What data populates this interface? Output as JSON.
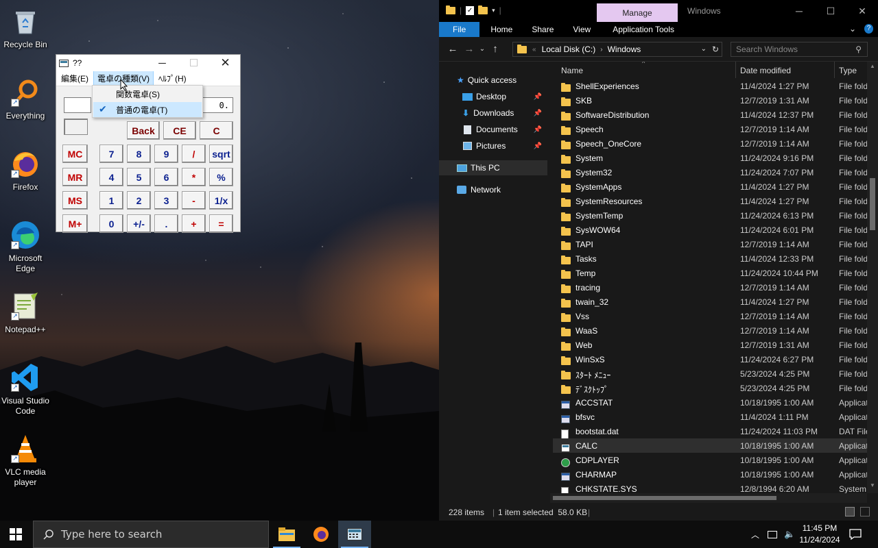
{
  "desktop": {
    "icons": [
      {
        "label": "Recycle Bin",
        "icon": "recycle-bin-icon"
      },
      {
        "label": "Everything",
        "icon": "everything-search-icon"
      },
      {
        "label": "Firefox",
        "icon": "firefox-icon"
      },
      {
        "label": "Microsoft Edge",
        "icon": "edge-icon"
      },
      {
        "label": "Notepad++",
        "icon": "notepadpp-icon"
      },
      {
        "label": "Visual Studio Code",
        "icon": "vscode-icon"
      },
      {
        "label": "VLC media player",
        "icon": "vlc-icon"
      }
    ]
  },
  "calculator": {
    "title": "??",
    "menu": [
      "編集(E)",
      "電卓の種類(V)",
      "ﾍﾙﾌﾟ(H)"
    ],
    "dropdown": [
      {
        "label": "関数電卓(S)",
        "checked": false
      },
      {
        "label": "普通の電卓(T)",
        "checked": true
      }
    ],
    "display": "0.",
    "buttons": {
      "back": "Back",
      "ce": "CE",
      "c": "C",
      "mc": "MC",
      "mr": "MR",
      "ms": "MS",
      "mplus": "M+",
      "n7": "7",
      "n8": "8",
      "n9": "9",
      "div": "/",
      "sqrt": "sqrt",
      "n4": "4",
      "n5": "5",
      "n6": "6",
      "mul": "*",
      "pct": "%",
      "n1": "1",
      "n2": "2",
      "n3": "3",
      "sub": "-",
      "recip": "1/x",
      "n0": "0",
      "sign": "+/-",
      "dot": ".",
      "add": "+",
      "eq": "="
    }
  },
  "explorer": {
    "title": "Windows",
    "context_tab": "Manage",
    "ribbon_tabs": [
      "File",
      "Home",
      "Share",
      "View",
      "Application Tools"
    ],
    "breadcrumb": [
      "Local Disk (C:)",
      "Windows"
    ],
    "search_placeholder": "Search Windows",
    "nav": {
      "quick_access": "Quick access",
      "desktop": "Desktop",
      "downloads": "Downloads",
      "documents": "Documents",
      "pictures": "Pictures",
      "this_pc": "This PC",
      "network": "Network"
    },
    "columns": [
      "Name",
      "Date modified",
      "Type"
    ],
    "files": [
      {
        "name": "ShellExperiences",
        "date": "11/4/2024 1:27 PM",
        "type": "File folder",
        "kind": "folder"
      },
      {
        "name": "SKB",
        "date": "12/7/2019 1:31 AM",
        "type": "File folder",
        "kind": "folder"
      },
      {
        "name": "SoftwareDistribution",
        "date": "11/4/2024 12:37 PM",
        "type": "File folder",
        "kind": "folder"
      },
      {
        "name": "Speech",
        "date": "12/7/2019 1:14 AM",
        "type": "File folder",
        "kind": "folder"
      },
      {
        "name": "Speech_OneCore",
        "date": "12/7/2019 1:14 AM",
        "type": "File folder",
        "kind": "folder"
      },
      {
        "name": "System",
        "date": "11/24/2024 9:16 PM",
        "type": "File folder",
        "kind": "folder"
      },
      {
        "name": "System32",
        "date": "11/24/2024 7:07 PM",
        "type": "File folder",
        "kind": "folder"
      },
      {
        "name": "SystemApps",
        "date": "11/4/2024 1:27 PM",
        "type": "File folder",
        "kind": "folder"
      },
      {
        "name": "SystemResources",
        "date": "11/4/2024 1:27 PM",
        "type": "File folder",
        "kind": "folder"
      },
      {
        "name": "SystemTemp",
        "date": "11/24/2024 6:13 PM",
        "type": "File folder",
        "kind": "folder"
      },
      {
        "name": "SysWOW64",
        "date": "11/24/2024 6:01 PM",
        "type": "File folder",
        "kind": "folder"
      },
      {
        "name": "TAPI",
        "date": "12/7/2019 1:14 AM",
        "type": "File folder",
        "kind": "folder"
      },
      {
        "name": "Tasks",
        "date": "11/4/2024 12:33 PM",
        "type": "File folder",
        "kind": "folder"
      },
      {
        "name": "Temp",
        "date": "11/24/2024 10:44 PM",
        "type": "File folder",
        "kind": "folder"
      },
      {
        "name": "tracing",
        "date": "12/7/2019 1:14 AM",
        "type": "File folder",
        "kind": "folder"
      },
      {
        "name": "twain_32",
        "date": "11/4/2024 1:27 PM",
        "type": "File folder",
        "kind": "folder"
      },
      {
        "name": "Vss",
        "date": "12/7/2019 1:14 AM",
        "type": "File folder",
        "kind": "folder"
      },
      {
        "name": "WaaS",
        "date": "12/7/2019 1:14 AM",
        "type": "File folder",
        "kind": "folder"
      },
      {
        "name": "Web",
        "date": "12/7/2019 1:31 AM",
        "type": "File folder",
        "kind": "folder"
      },
      {
        "name": "WinSxS",
        "date": "11/24/2024 6:27 PM",
        "type": "File folder",
        "kind": "folder"
      },
      {
        "name": "ｽﾀｰﾄ ﾒﾆｭｰ",
        "date": "5/23/2024 4:25 PM",
        "type": "File folder",
        "kind": "folder"
      },
      {
        "name": "ﾃﾞｽｸﾄｯﾌﾟ",
        "date": "5/23/2024 4:25 PM",
        "type": "File folder",
        "kind": "folder"
      },
      {
        "name": "ACCSTAT",
        "date": "10/18/1995 1:00 AM",
        "type": "Application",
        "kind": "app"
      },
      {
        "name": "bfsvc",
        "date": "11/4/2024 1:11 PM",
        "type": "Application",
        "kind": "app"
      },
      {
        "name": "bootstat.dat",
        "date": "11/24/2024 11:03 PM",
        "type": "DAT File",
        "kind": "file"
      },
      {
        "name": "CALC",
        "date": "10/18/1995 1:00 AM",
        "type": "Application",
        "kind": "calc",
        "selected": true
      },
      {
        "name": "CDPLAYER",
        "date": "10/18/1995 1:00 AM",
        "type": "Application",
        "kind": "cd"
      },
      {
        "name": "CHARMAP",
        "date": "10/18/1995 1:00 AM",
        "type": "Application",
        "kind": "app"
      },
      {
        "name": "CHKSTATE.SYS",
        "date": "12/8/1994 6:20 AM",
        "type": "System file",
        "kind": "file"
      }
    ],
    "status": {
      "count": "228 items",
      "selected": "1 item selected  58.0 KB"
    }
  },
  "taskbar": {
    "search_placeholder": "Type here to search",
    "time": "11:45 PM",
    "date": "11/24/2024"
  }
}
